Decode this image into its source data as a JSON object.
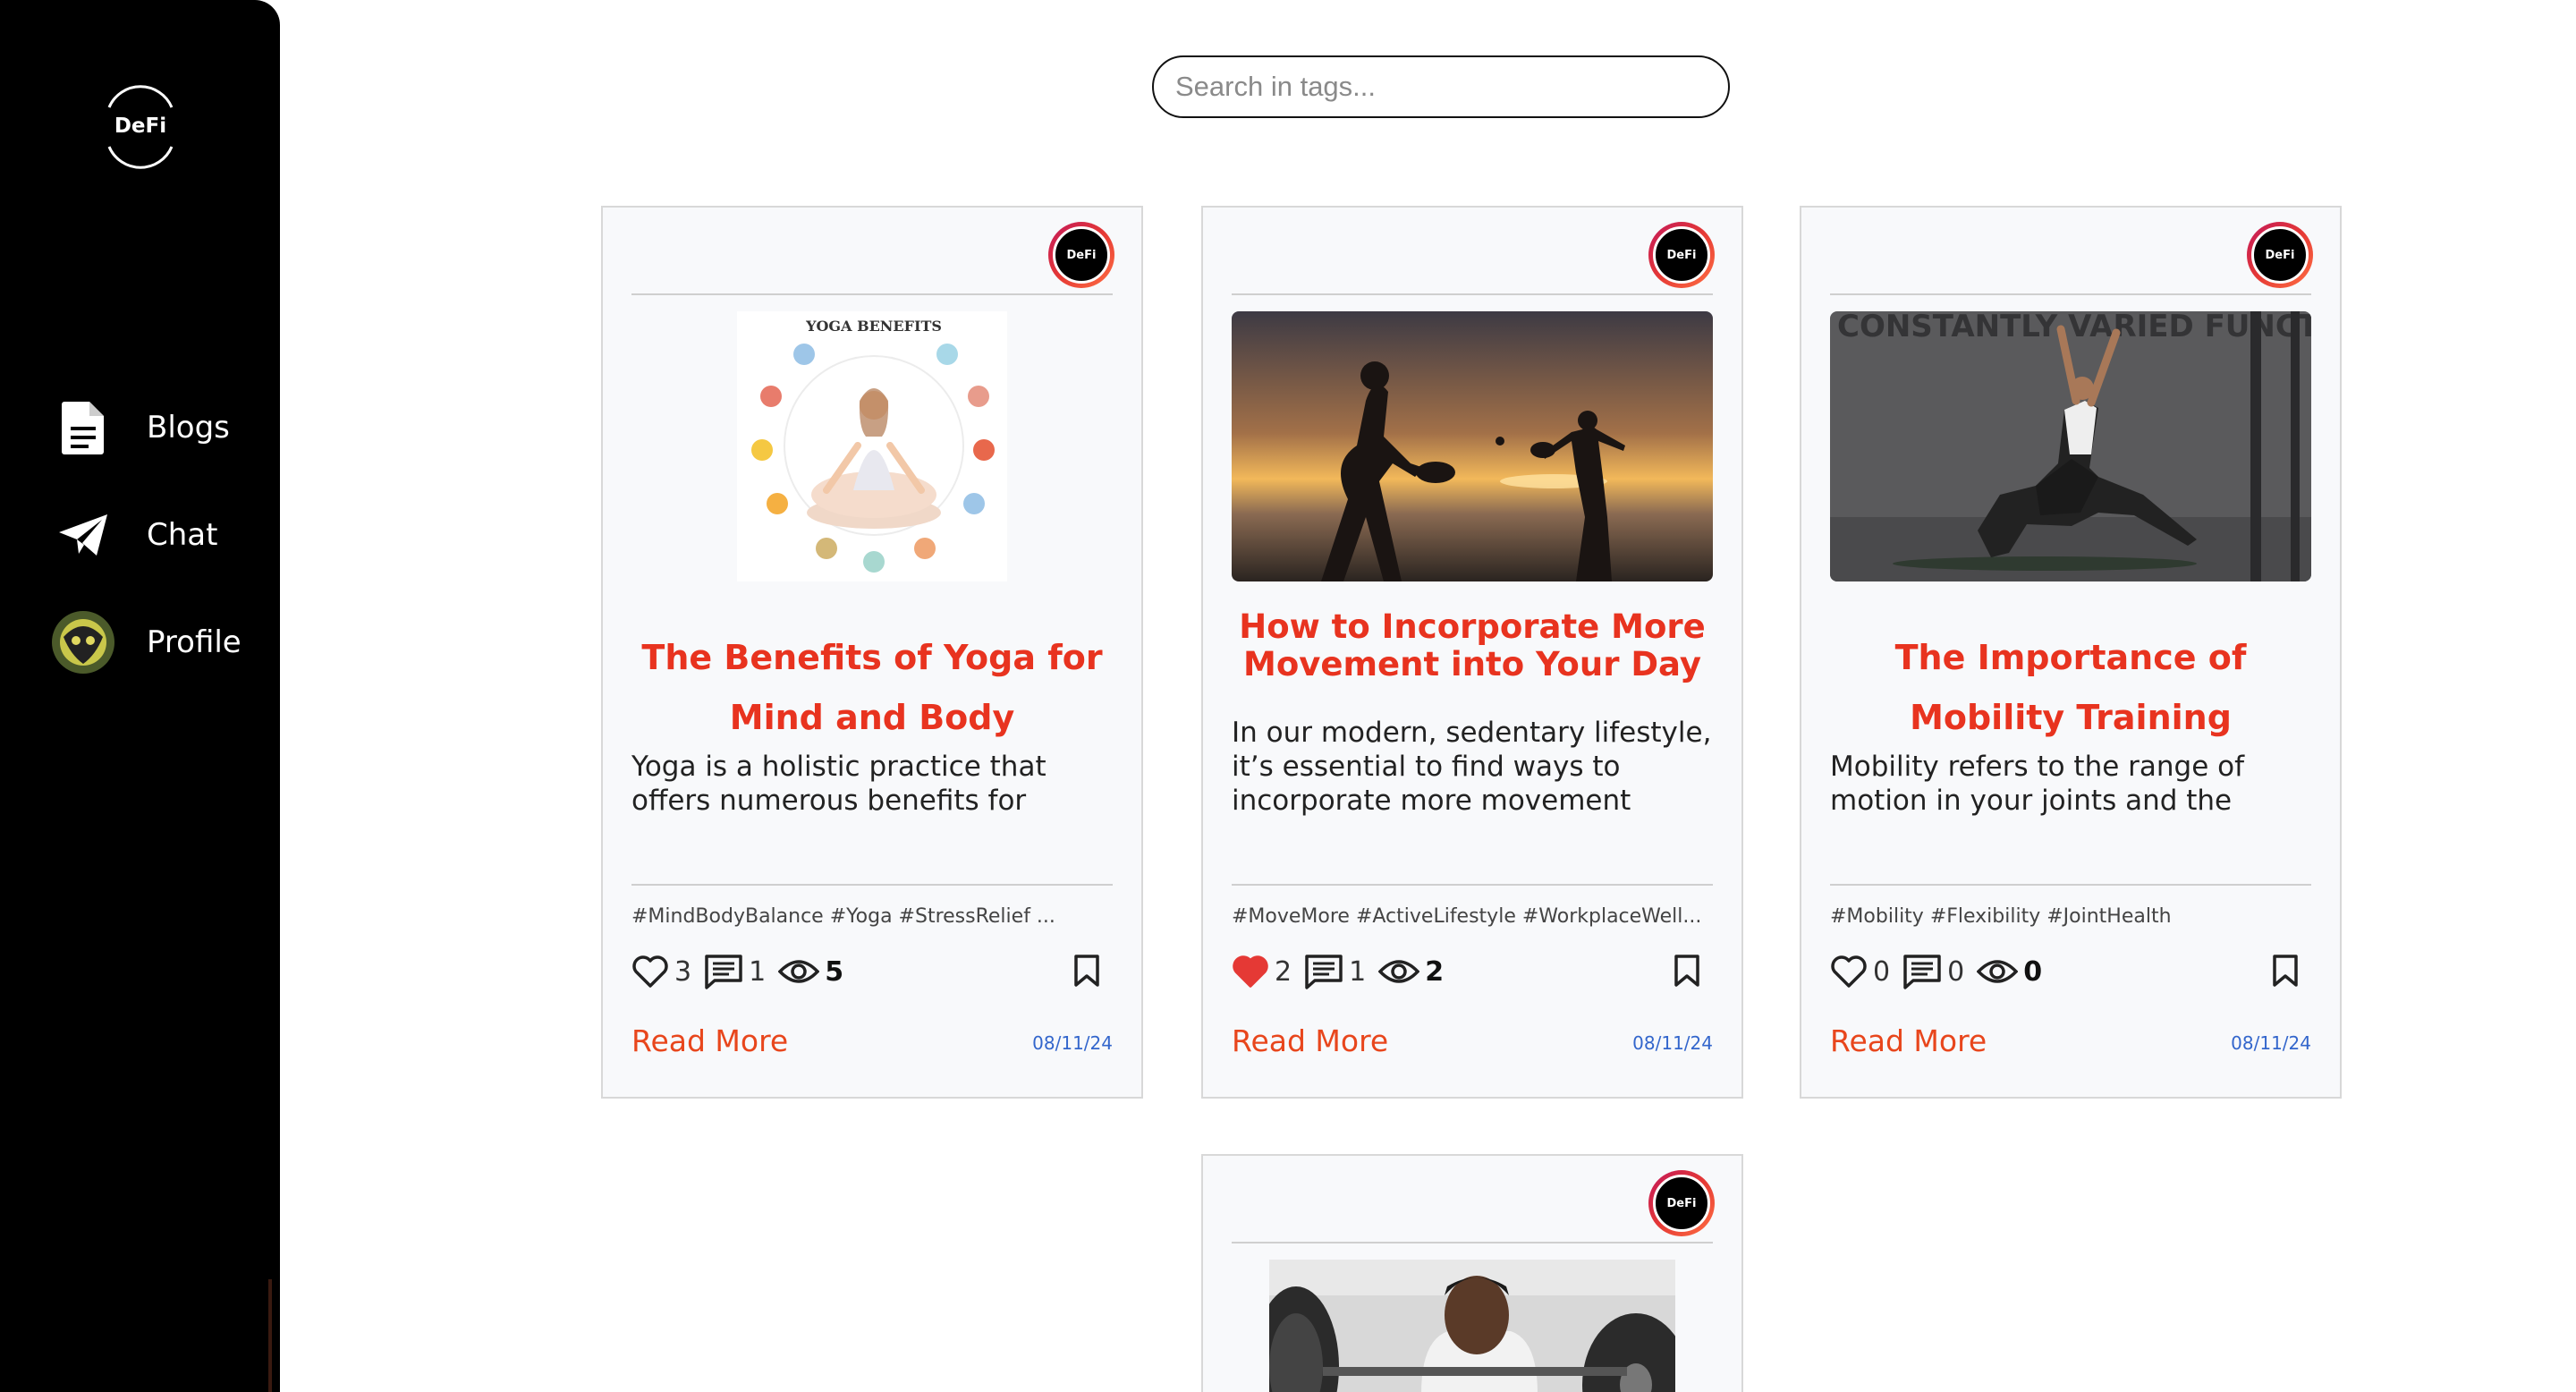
{
  "brand": {
    "logo_text": "DeFi"
  },
  "sidebar": {
    "items": [
      {
        "label": "Blogs",
        "icon": "document-icon"
      },
      {
        "label": "Chat",
        "icon": "paper-plane-icon"
      },
      {
        "label": "Profile",
        "icon": "avatar"
      }
    ]
  },
  "search": {
    "placeholder": "Search in tags..."
  },
  "colors": {
    "title": "#e8331f",
    "read_more": "#e8461c",
    "date": "#3366cc",
    "liked_heart": "#e53935"
  },
  "cards": [
    {
      "avatar_text": "DeFi",
      "title": "The Benefits of Yoga for Mind and Body",
      "excerpt": "Yoga is a holistic practice that offers numerous benefits for",
      "tags": "#MindBodyBalance #Yoga #StressRelief ...",
      "likes": "3",
      "liked": false,
      "comments": "1",
      "views": "5",
      "read_more": "Read More",
      "date": "08/11/24",
      "image_heading": "YOGA BENEFITS"
    },
    {
      "avatar_text": "DeFi",
      "title": "How to Incorporate More Movement into Your Day",
      "excerpt": "In our modern, sedentary lifestyle, it’s essential to find ways to incorporate more movement",
      "tags": "#MoveMore #ActiveLifestyle #WorkplaceWell...",
      "likes": "2",
      "liked": true,
      "comments": "1",
      "views": "2",
      "read_more": "Read More",
      "date": "08/11/24"
    },
    {
      "avatar_text": "DeFi",
      "title": "The Importance of Mobility Training",
      "excerpt": "Mobility refers to the range of motion in your joints and the",
      "tags": "#Mobility #Flexibility #JointHealth",
      "likes": "0",
      "liked": false,
      "comments": "0",
      "views": "0",
      "read_more": "Read More",
      "date": "08/11/24",
      "image_wall_text": "CONSTANTLY VARIED FUNCTIONAL MOVEMENT HIGH INTENSITY"
    },
    {
      "avatar_text": "DeFi"
    }
  ]
}
